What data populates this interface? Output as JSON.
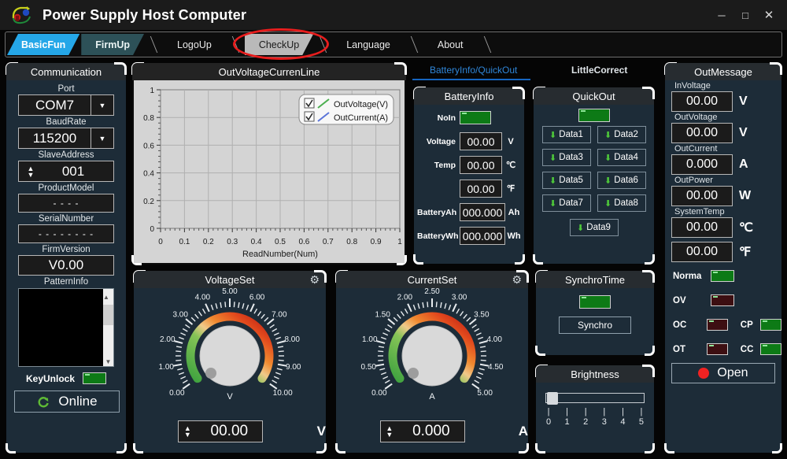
{
  "window": {
    "title": "Power Supply Host Computer",
    "logo_icon": "power-supply-logo",
    "minimize_glyph": "─",
    "maximize_glyph": "□",
    "close_glyph": "✕",
    "accent_blue": "#25A7E8",
    "panel_bg": "#1d2c38",
    "panel_head_bg": "#272c30"
  },
  "tabs": [
    {
      "label": "BasicFun",
      "state": "active"
    },
    {
      "label": "FirmUp",
      "state": "dim"
    },
    {
      "label": "LogoUp",
      "state": "plain"
    },
    {
      "label": "CheckUp",
      "state": "hover"
    },
    {
      "label": "Language",
      "state": "plain"
    },
    {
      "label": "About",
      "state": "plain"
    }
  ],
  "highlight": {
    "shape": "red-ellipse",
    "target": "CheckUp",
    "color": "#e81d1d"
  },
  "communication": {
    "title": "Communication",
    "port_label": "Port",
    "port_value": "COM7",
    "baud_label": "BaudRate",
    "baud_value": "115200",
    "slave_label": "SlaveAddress",
    "slave_value": "001",
    "product_label": "ProductModel",
    "product_value": "- - - -",
    "serial_label": "SerialNumber",
    "serial_value": "- - - - - - - -",
    "firm_label": "FirmVersion",
    "firm_value": "V0.00",
    "pattern_label": "PatternInfo",
    "pattern_value": "",
    "keyunlock_label": "KeyUnlock",
    "keyunlock_state": "green",
    "online_label": "Online",
    "online_icon": "refresh-icon",
    "dropdown_icon": "chevron-down-icon",
    "spinner_icon": "up-down-arrows-icon",
    "scroll_up_icon": "chevron-up-icon",
    "scroll_down_icon": "chevron-down-icon"
  },
  "chart_data": {
    "type": "line",
    "title": "OutVoltageCurrenLine",
    "xlabel": "ReadNumber(Num)",
    "ylabel": "",
    "xlim": [
      0,
      1
    ],
    "ylim": [
      0,
      1
    ],
    "xticks": [
      "0",
      "0.1",
      "0.2",
      "0.3",
      "0.4",
      "0.5",
      "0.6",
      "0.7",
      "0.8",
      "0.9",
      "1"
    ],
    "yticks": [
      "0",
      "0.2",
      "0.4",
      "0.6",
      "0.8",
      "1"
    ],
    "grid": true,
    "legend_position": "top-right",
    "series": [
      {
        "name": "OutVoltage(V)",
        "color": "#4caf50",
        "checked": true,
        "x": [],
        "values": []
      },
      {
        "name": "OutCurrent(A)",
        "color": "#5a74d8",
        "checked": true,
        "x": [],
        "values": []
      }
    ]
  },
  "center_tabs": [
    {
      "label": "BatteryInfo/QuickOut",
      "selected": true
    },
    {
      "label": "LittleCorrect",
      "selected": false
    }
  ],
  "battery_info": {
    "title": "BatteryInfo",
    "noin_label": "NoIn",
    "noin_state": "green",
    "rows": [
      {
        "label": "Voltage",
        "value": "00.00",
        "unit": "V"
      },
      {
        "label": "Temp",
        "value": "00.00",
        "unit": "℃"
      },
      {
        "label": "",
        "value": "00.00",
        "unit": "℉"
      },
      {
        "label": "BatteryAh",
        "value": "000.000",
        "unit": "Ah"
      },
      {
        "label": "BatteryWh",
        "value": "000.000",
        "unit": "Wh"
      }
    ]
  },
  "quick_out": {
    "title": "QuickOut",
    "status_state": "green",
    "download_icon": "download-arrow-icon",
    "buttons": [
      "Data1",
      "Data2",
      "Data3",
      "Data4",
      "Data5",
      "Data6",
      "Data7",
      "Data8",
      "Data9"
    ]
  },
  "out_message": {
    "title": "OutMessage",
    "readouts": [
      {
        "label": "InVoltage",
        "value": "00.00",
        "unit": "V"
      },
      {
        "label": "OutVoltage",
        "value": "00.00",
        "unit": "V"
      },
      {
        "label": "OutCurrent",
        "value": "0.000",
        "unit": "A"
      },
      {
        "label": "OutPower",
        "value": "00.00",
        "unit": "W"
      },
      {
        "label": "SystemTemp",
        "value": "00.00",
        "unit": "℃"
      },
      {
        "label": "",
        "value": "00.00",
        "unit": "℉"
      }
    ],
    "status": [
      {
        "left_label": "Norma",
        "left_state": "green",
        "right_label": "",
        "right_state": ""
      },
      {
        "left_label": "OV",
        "left_state": "red",
        "right_label": "",
        "right_state": ""
      },
      {
        "left_label": "OC",
        "left_state": "red",
        "right_label": "CP",
        "right_state": "green"
      },
      {
        "left_label": "OT",
        "left_state": "red",
        "right_label": "CC",
        "right_state": "green"
      }
    ],
    "open_label": "Open",
    "open_icon": "power-dot-icon"
  },
  "voltage_set": {
    "title": "VoltageSet",
    "gear_icon": "gear-icon",
    "unit_inner": "V",
    "unit_outer": "V",
    "value": "00.00",
    "ticks": [
      "0.00",
      "1.00",
      "2.00",
      "3.00",
      "4.00",
      "5.00",
      "6.00",
      "7.00",
      "8.00",
      "9.00",
      "10.00"
    ],
    "min": 0,
    "max": 10,
    "current": 0,
    "spinner_icon": "up-down-arrows-icon"
  },
  "current_set": {
    "title": "CurrentSet",
    "gear_icon": "gear-icon",
    "unit_inner": "A",
    "unit_outer": "A",
    "value": "0.000",
    "ticks": [
      "0.00",
      "0.50",
      "1.00",
      "1.50",
      "2.00",
      "2.50",
      "3.00",
      "3.50",
      "4.00",
      "4.50",
      "5.00"
    ],
    "min": 0,
    "max": 5,
    "current": 0,
    "spinner_icon": "up-down-arrows-icon"
  },
  "synchro_time": {
    "title": "SynchroTime",
    "status_state": "green",
    "button_label": "Synchro"
  },
  "brightness": {
    "title": "Brightness",
    "value": 0,
    "ticks": [
      "0",
      "1",
      "2",
      "3",
      "4",
      "5"
    ]
  }
}
